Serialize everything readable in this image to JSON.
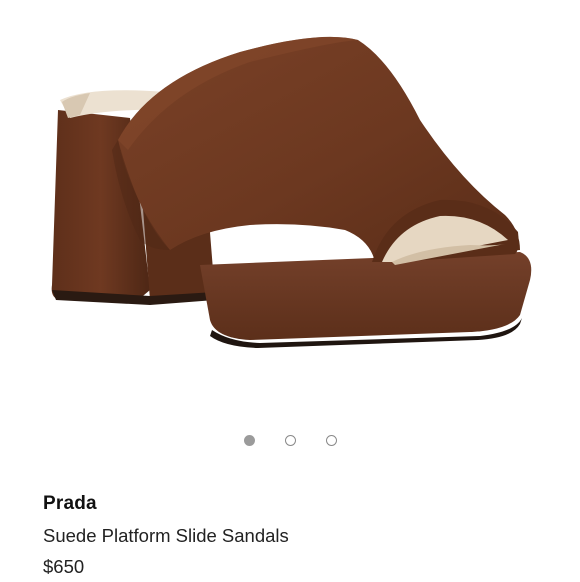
{
  "carousel": {
    "image_alt": "Brown suede platform slide sandal",
    "dots": [
      {
        "active": true
      },
      {
        "active": false
      },
      {
        "active": false
      }
    ]
  },
  "product": {
    "brand": "Prada",
    "name": "Suede Platform Slide Sandals",
    "price": "$650"
  },
  "colors": {
    "suede": "#6e3a22",
    "suede_dark": "#4f2816",
    "suede_light": "#85492c",
    "insole": "#e9ddcc",
    "dot_active": "#9b9b9b"
  }
}
